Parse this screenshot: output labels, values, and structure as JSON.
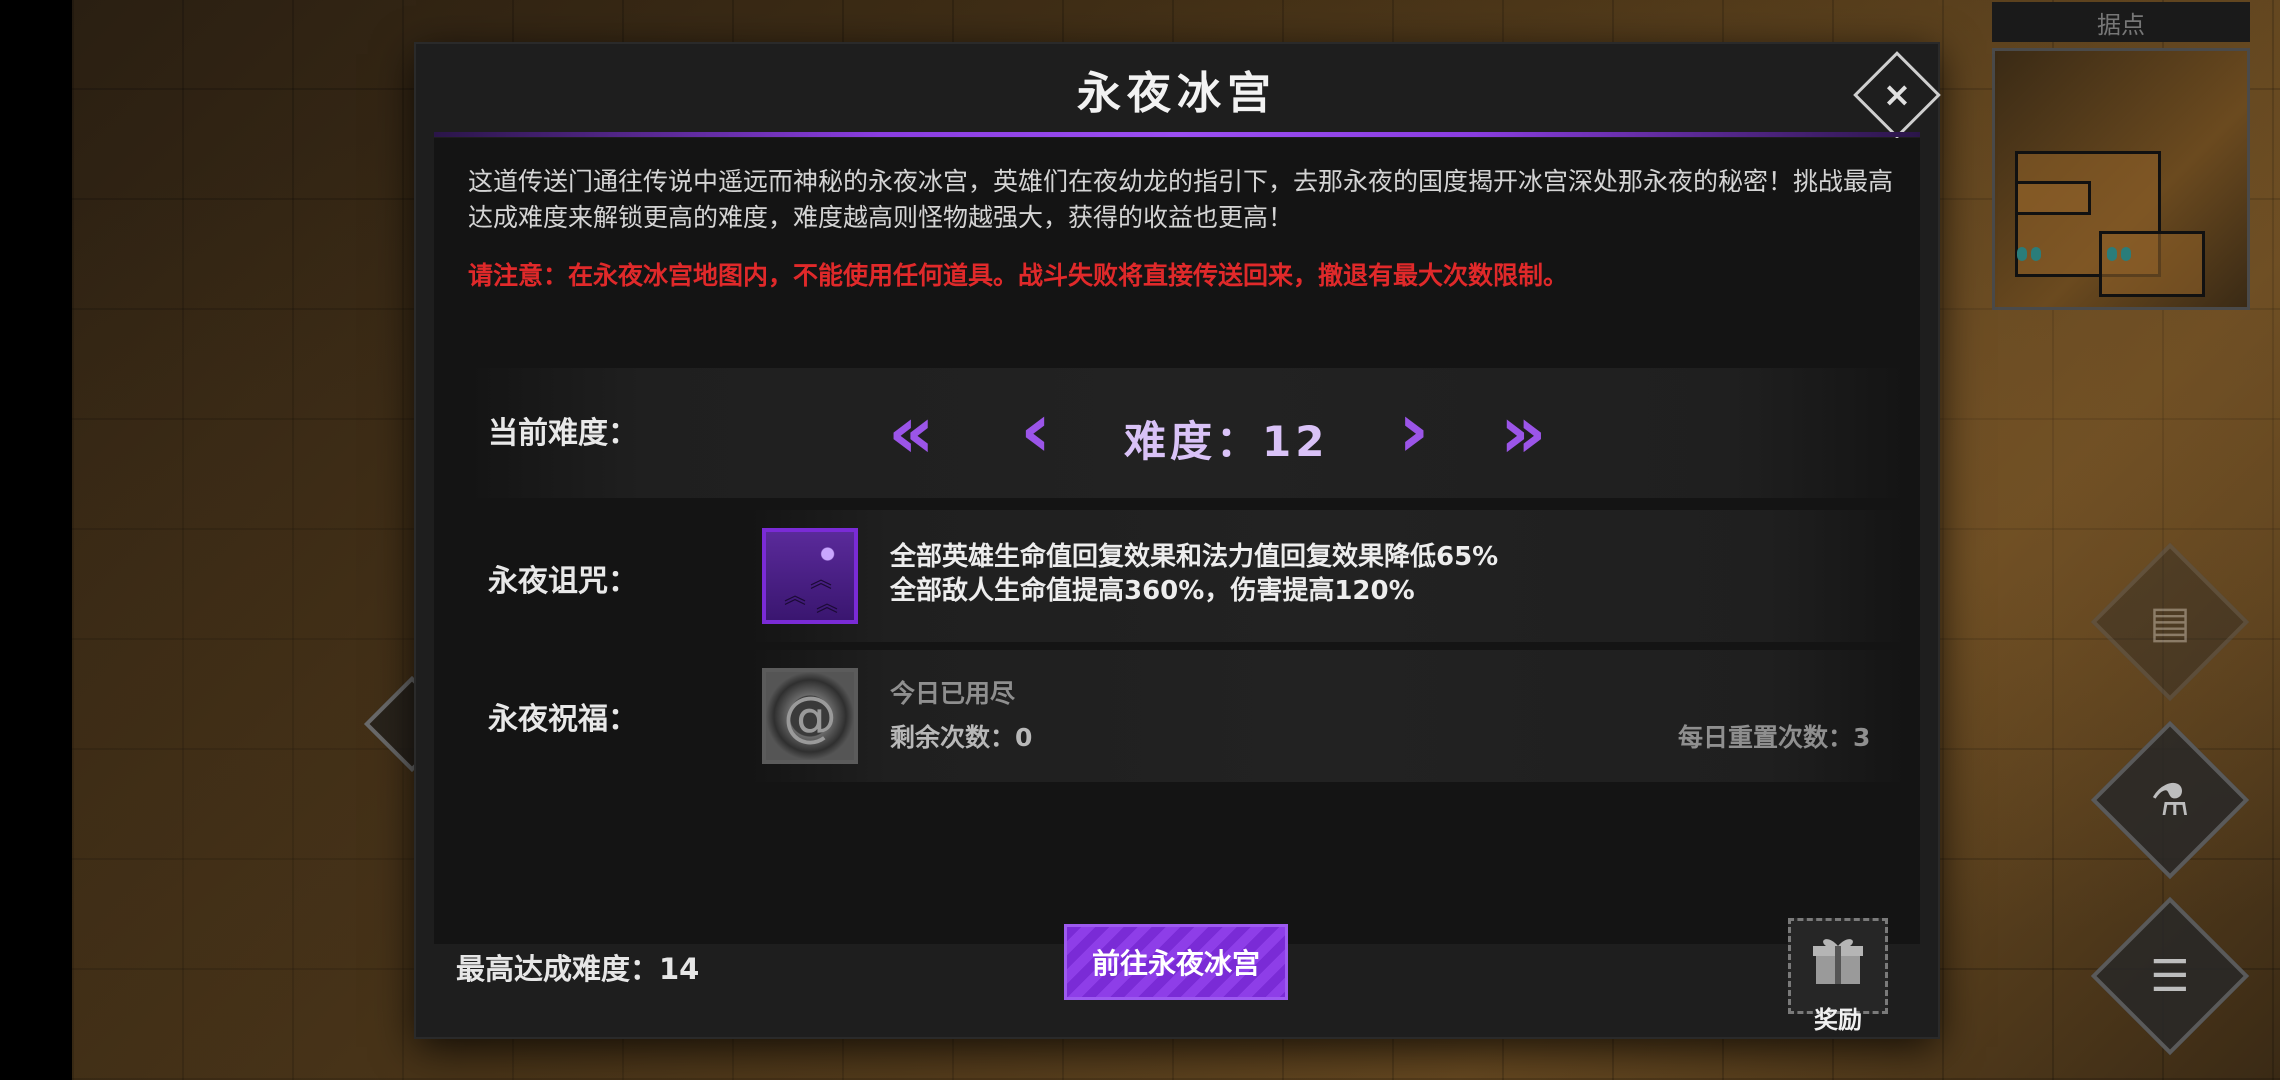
{
  "minimap": {
    "title": "据点"
  },
  "dialog": {
    "title": "永夜冰宫",
    "close_glyph": "×",
    "description": "这道传送门通往传说中遥远而神秘的永夜冰宫，英雄们在夜幼龙的指引下，去那永夜的国度揭开冰宫深处那永夜的秘密！挑战最高达成难度来解锁更高的难度，难度越高则怪物越强大，获得的收益也更高！",
    "warning": "请注意：在永夜冰宫地图内，不能使用任何道具。战斗失败将直接传送回来，撤退有最大次数限制。",
    "difficulty": {
      "label": "当前难度：",
      "value_text": "难度：12",
      "first_glyph": "«",
      "prev_glyph": "‹",
      "next_glyph": "›",
      "last_glyph": "»"
    },
    "curse": {
      "label": "永夜诅咒：",
      "line1": "全部英雄生命值回复效果和法力值回复效果降低65%",
      "line2": "全部敌人生命值提高360%，伤害提高120%"
    },
    "blessing": {
      "label": "永夜祝福：",
      "status": "今日已用尽",
      "remaining": "剩余次数：0",
      "daily_reset": "每日重置次数：3"
    },
    "footer": {
      "best_difficulty": "最高达成难度：14",
      "go_button": "前往永夜冰宫",
      "reward_label": "奖励"
    }
  },
  "colors": {
    "accent": "#8e3ee8",
    "warning": "#e0292a"
  }
}
